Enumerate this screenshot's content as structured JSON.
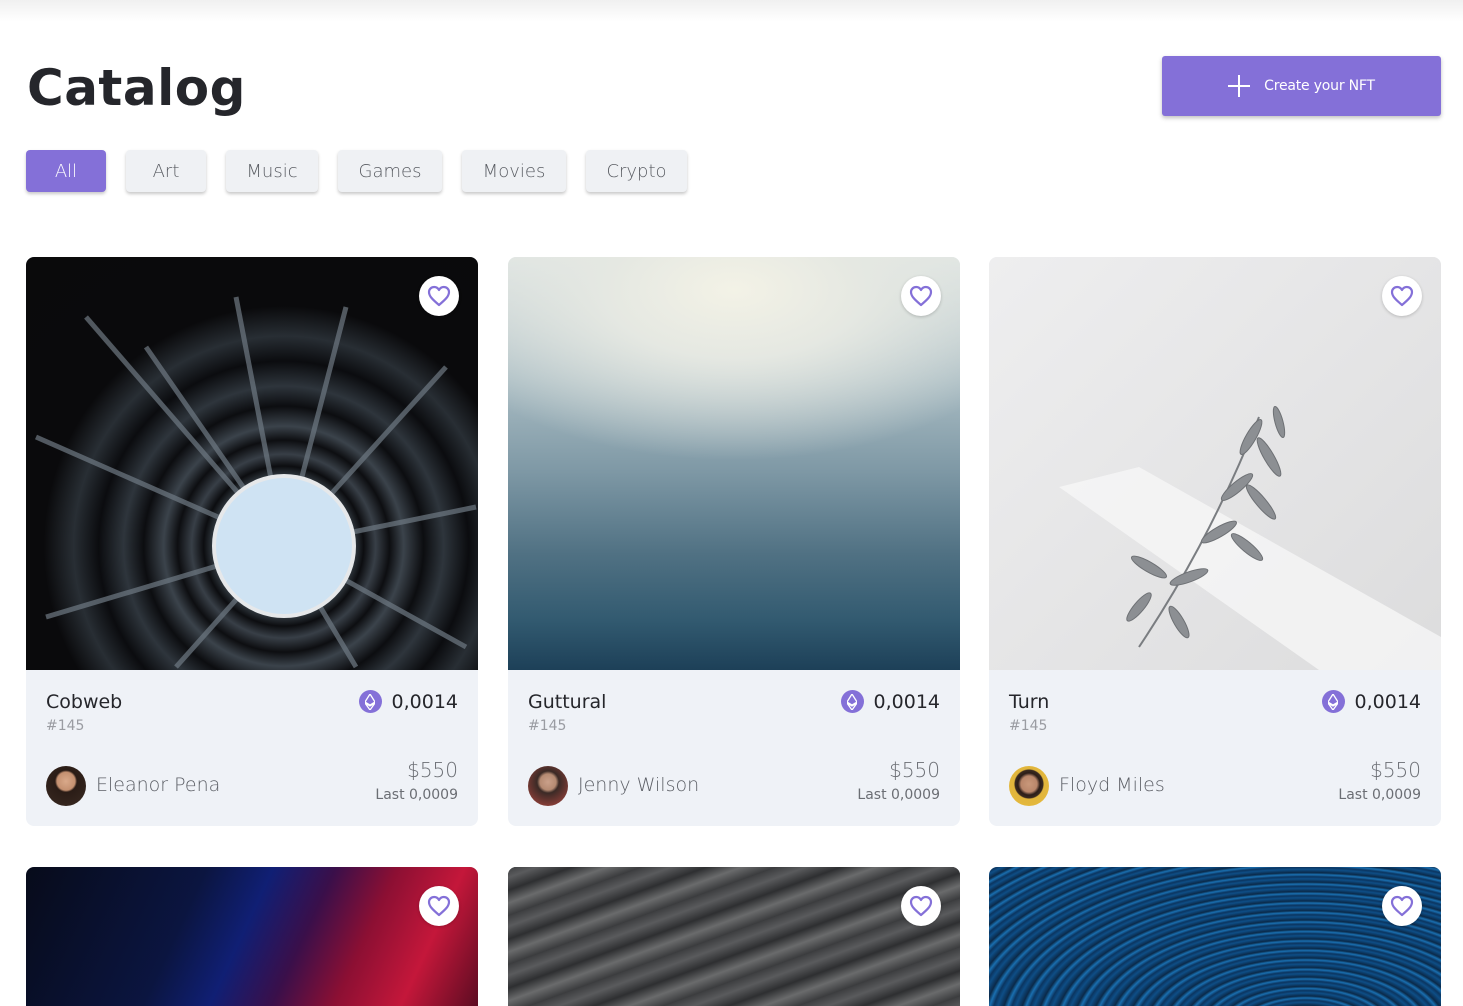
{
  "page": {
    "title": "Catalog"
  },
  "create_button": {
    "label": "Create your NFT",
    "icon": "plus-icon"
  },
  "filters": [
    {
      "label": "All",
      "active": true
    },
    {
      "label": "Art",
      "active": false
    },
    {
      "label": "Music",
      "active": false
    },
    {
      "label": "Games",
      "active": false
    },
    {
      "label": "Movies",
      "active": false
    },
    {
      "label": "Crypto",
      "active": false
    }
  ],
  "cards": [
    {
      "name": "Cobweb",
      "id": "#145",
      "eth": "0,0014",
      "owner": "Eleanor Pena",
      "usd": "$550",
      "last": "Last 0,0009"
    },
    {
      "name": "Guttural",
      "id": "#145",
      "eth": "0,0014",
      "owner": "Jenny Wilson",
      "usd": "$550",
      "last": "Last 0,0009"
    },
    {
      "name": "Turn",
      "id": "#145",
      "eth": "0,0014",
      "owner": "Floyd Miles",
      "usd": "$550",
      "last": "Last 0,0009"
    }
  ],
  "colors": {
    "accent": "#8470d8",
    "card_bg": "#eff2f7",
    "chip_bg": "#eff1f4"
  }
}
